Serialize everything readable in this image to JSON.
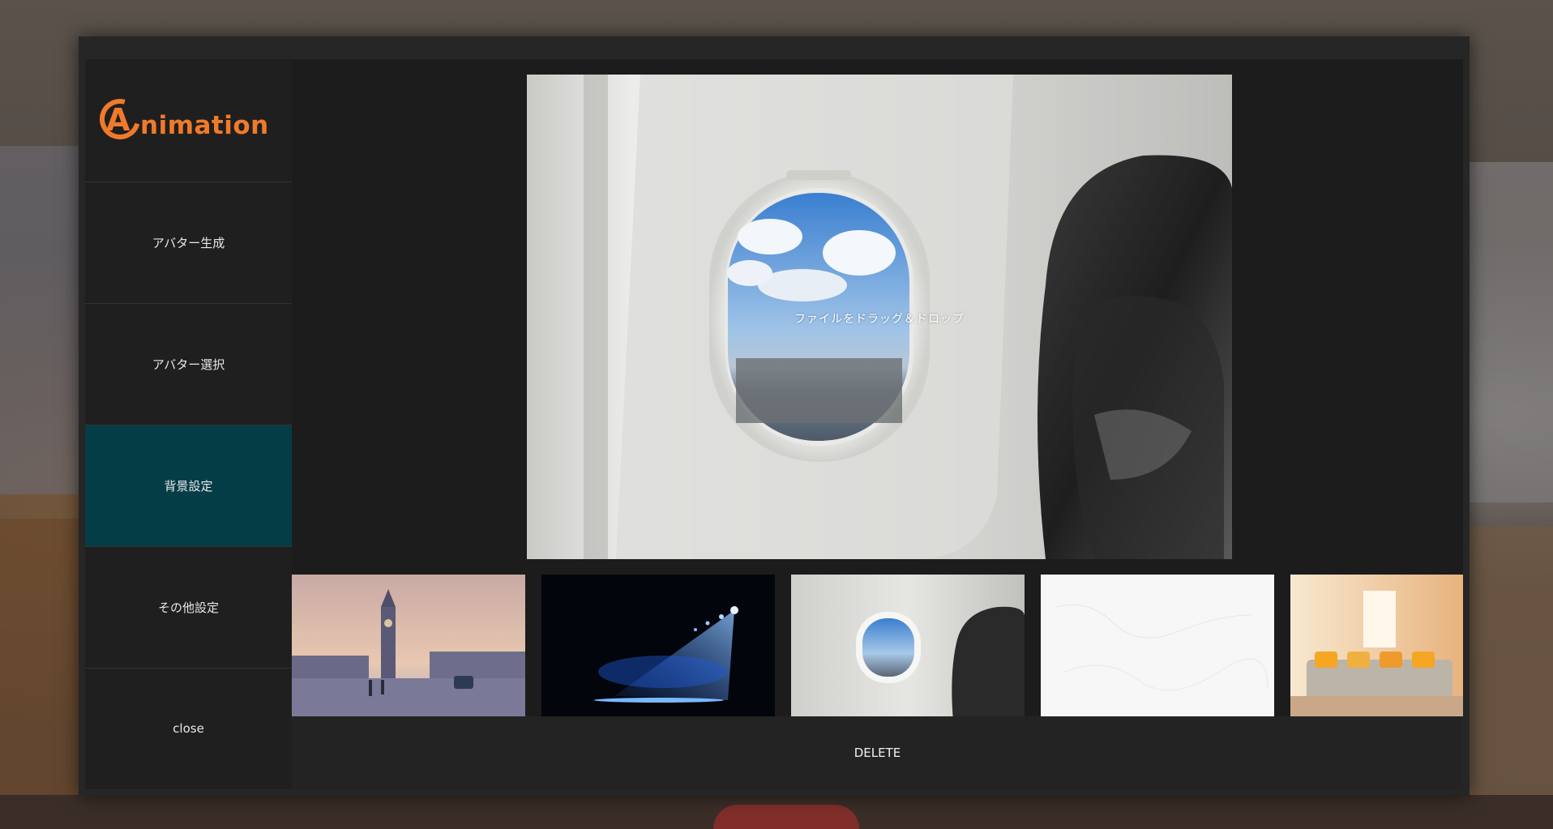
{
  "app": {
    "logo_text": "nimation",
    "logo_mark": "A",
    "accent_color": "#f07a2a",
    "active_color": "#053d47"
  },
  "sidebar": {
    "items": [
      {
        "label": "アバター生成"
      },
      {
        "label": "アバター選択"
      },
      {
        "label": "背景設定",
        "active": true
      },
      {
        "label": "その他設定"
      },
      {
        "label": "close"
      }
    ]
  },
  "preview": {
    "drop_hint": "ファイルをドラッグ＆ドロップ",
    "selected_background": "airplane-window"
  },
  "backgrounds": [
    {
      "name": "big-ben-street"
    },
    {
      "name": "blue-spotlight-stage"
    },
    {
      "name": "airplane-window"
    },
    {
      "name": "white-texture"
    },
    {
      "name": "bright-bedroom"
    }
  ],
  "actions": {
    "delete_label": "DELETE"
  }
}
